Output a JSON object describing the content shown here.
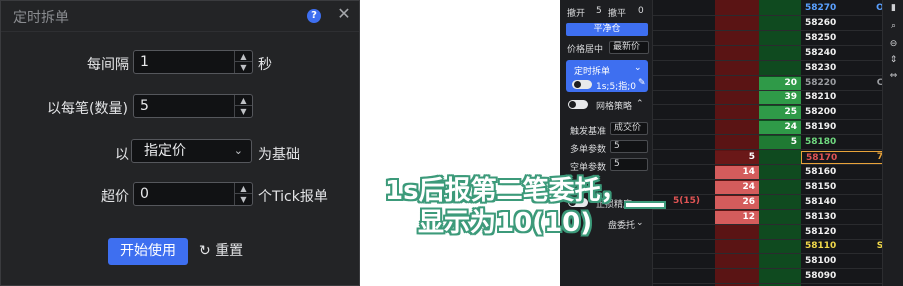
{
  "dialog": {
    "title": "定时拆单",
    "interval_label": "每间隔",
    "interval_value": "1",
    "interval_unit": "秒",
    "per_label": "以每笔(数量)",
    "per_value": "5",
    "base_prefix": "以",
    "base_option": "指定价",
    "base_suffix": "为基础",
    "over_label": "超价",
    "over_value": "0",
    "over_unit": "个Tick报单",
    "start_button": "开始使用",
    "reset_button": "重置"
  },
  "panel": {
    "top_row": [
      "撤开",
      "5",
      "撤平",
      "0"
    ],
    "flatten_button": "平净仓",
    "price_center_label": "价格居中",
    "price_center_value": "最新价",
    "split_title": "定时拆单",
    "split_detail": "1s;5;指;0",
    "grid_label": "网格策略",
    "trigger_label": "触发基准",
    "trigger_value": "成交价",
    "long_label": "多单参数",
    "long_value": "5",
    "short_label": "空单参数",
    "short_value": "5",
    "misc_label": "止损精度",
    "pending_label": "盘委托",
    "pending_order": "5(15)",
    "prices": [
      "58270",
      "58260",
      "58250",
      "58240",
      "58230",
      "58220",
      "58210",
      "58200",
      "58190",
      "58180",
      "58170",
      "58160",
      "58150",
      "58140",
      "58130",
      "58120",
      "58110",
      "58100",
      "58090"
    ],
    "ask_volumes": [
      "",
      "",
      "",
      "",
      "",
      "20",
      "39",
      "25",
      "24",
      "5",
      "",
      "",
      "",
      "",
      "",
      "",
      "",
      "",
      ""
    ],
    "bid_volumes": [
      "",
      "",
      "",
      "",
      "",
      "",
      "",
      "",
      "",
      "",
      "5",
      "14",
      "24",
      "26",
      "12",
      "",
      "",
      "",
      ""
    ],
    "right_tags": [
      "O",
      "",
      "",
      "",
      "",
      "C",
      "",
      "",
      "",
      "",
      "7",
      "",
      "",
      "",
      "",
      "",
      "S",
      "",
      ""
    ]
  },
  "caption": {
    "line1": "1s后报第二笔委托，",
    "line2": "显示为10(10)"
  },
  "colors": {
    "primary_blue": "#3e6ff0",
    "ask_green": "#1f7a33",
    "bid_red": "#b22a2a",
    "highlight_orange": "#e8a33a"
  }
}
